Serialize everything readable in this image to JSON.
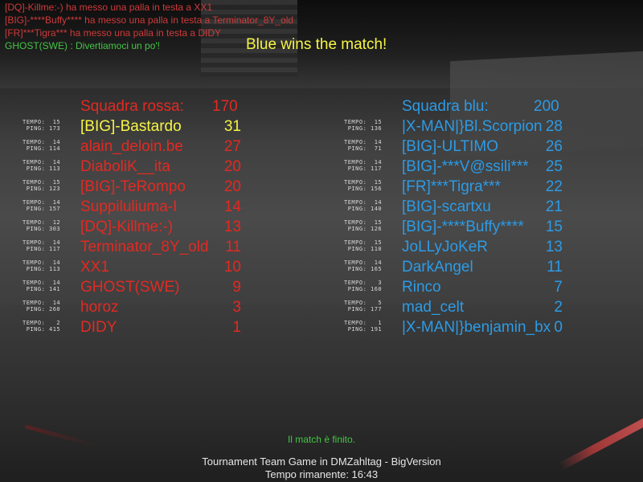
{
  "colors": {
    "red_team": "#e12a23",
    "blue_team": "#2c9be6",
    "highlight": "#f7f545",
    "chat_system": "#cf3a3a",
    "chat_player": "#45c545"
  },
  "chat": [
    {
      "text": "[DQ]-Killme:-) ha messo una palla in testa a XX1",
      "color": "#cf3a3a"
    },
    {
      "text": "[BIG]-****Buffy**** ha messo una palla in testa a Terminator_8Y_old",
      "color": "#cf3a3a"
    },
    {
      "text": "[FR]***Tigra*** ha messo una palla in testa a DIDY",
      "color": "#cf3a3a"
    },
    {
      "text": "GHOST(SWE) : Divertiamoci un po'!",
      "color": "#45c545"
    }
  ],
  "headline": "Blue wins the match!",
  "red_team": {
    "label": "Squadra rossa:",
    "score": "170",
    "players": [
      {
        "tempo": "TEMPO:  15",
        "ping": " PING: 173",
        "name": "[BIG]-Bastardo",
        "score": "31",
        "highlight": true
      },
      {
        "tempo": "TEMPO:  14",
        "ping": " PING: 114",
        "name": "alain_deloin.be",
        "score": "27"
      },
      {
        "tempo": "TEMPO:  14",
        "ping": " PING: 113",
        "name": "DiaboliK__ita",
        "score": "20"
      },
      {
        "tempo": "TEMPO:  15",
        "ping": " PING: 123",
        "name": "[BIG]-TeRompo",
        "score": "20"
      },
      {
        "tempo": "TEMPO:  14",
        "ping": " PING: 157",
        "name": "Suppiluliuma-I",
        "score": "14"
      },
      {
        "tempo": "TEMPO:  12",
        "ping": " PING: 303",
        "name": "[DQ]-Killme:-)",
        "score": "13"
      },
      {
        "tempo": "TEMPO:  14",
        "ping": " PING: 117",
        "name": "Terminator_8Y_old",
        "score": "11"
      },
      {
        "tempo": "TEMPO:  14",
        "ping": " PING: 113",
        "name": "XX1",
        "score": "10"
      },
      {
        "tempo": "TEMPO:  14",
        "ping": " PING: 141",
        "name": "GHOST(SWE)",
        "score": "9"
      },
      {
        "tempo": "TEMPO:  14",
        "ping": " PING: 260",
        "name": "horoz",
        "score": "3"
      },
      {
        "tempo": "TEMPO:   2",
        "ping": " PING: 415",
        "name": "DIDY",
        "score": "1"
      }
    ]
  },
  "blue_team": {
    "label": "Squadra blu:",
    "score": "200",
    "players": [
      {
        "tempo": "TEMPO:  15",
        "ping": " PING: 136",
        "name": "|X-MAN|}Bl.Scorpion",
        "score": "28"
      },
      {
        "tempo": "TEMPO:  14",
        "ping": " PING:  71",
        "name": "[BIG]-ULTIMO",
        "score": "26"
      },
      {
        "tempo": "TEMPO:  14",
        "ping": " PING: 117",
        "name": "[BIG]-***V@ssili***",
        "score": "25"
      },
      {
        "tempo": "TEMPO:  15",
        "ping": " PING: 156",
        "name": "[FR]***Tigra***",
        "score": "22"
      },
      {
        "tempo": "TEMPO:  14",
        "ping": " PING: 140",
        "name": "[BIG]-scartxu",
        "score": "21"
      },
      {
        "tempo": "TEMPO:  15",
        "ping": " PING: 126",
        "name": "[BIG]-****Buffy****",
        "score": "15"
      },
      {
        "tempo": "TEMPO:  15",
        "ping": " PING: 110",
        "name": "JoLLyJoKeR",
        "score": "13"
      },
      {
        "tempo": "TEMPO:  14",
        "ping": " PING: 165",
        "name": "DarkAngel",
        "score": "11"
      },
      {
        "tempo": "TEMPO:   3",
        "ping": " PING: 160",
        "name": "Rinco",
        "score": "7"
      },
      {
        "tempo": "TEMPO:   5",
        "ping": " PING: 177",
        "name": "mad_celt",
        "score": "2"
      },
      {
        "tempo": "TEMPO:   1",
        "ping": " PING: 191",
        "name": "|X-MAN|}benjamin_bx",
        "score": "0"
      }
    ]
  },
  "footer": {
    "message": "Il match è finito.",
    "title": "Tournament Team Game in DMZahltag - BigVersion",
    "time": "Tempo rimanente:  16:43"
  }
}
